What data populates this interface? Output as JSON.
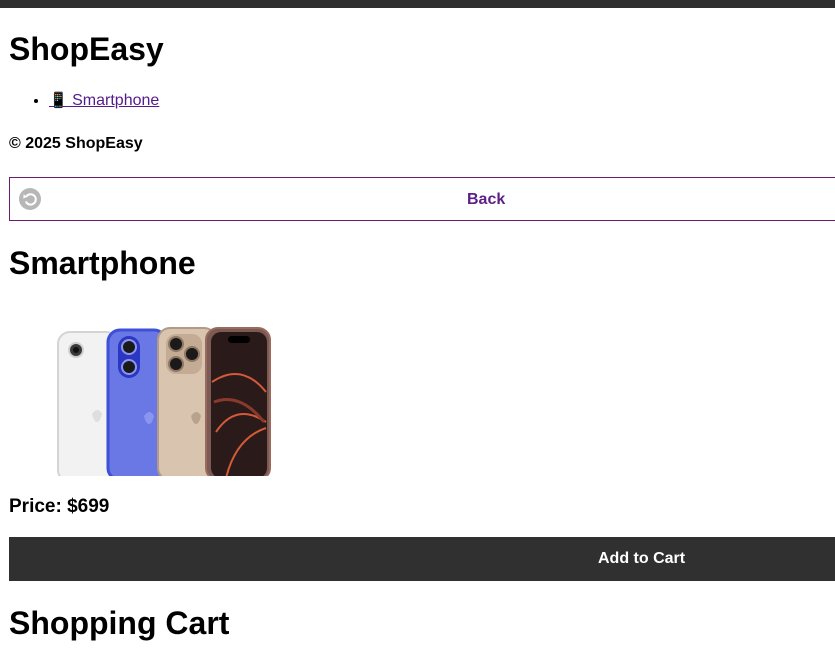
{
  "header": {
    "title": "ShopEasy"
  },
  "nav": {
    "items": [
      {
        "icon": "📱",
        "label": " Smartphone"
      }
    ]
  },
  "footer": {
    "text": "© 2025 ShopEasy"
  },
  "back_button": {
    "label": "Back",
    "icon": "undo-arrow-icon"
  },
  "product": {
    "name": "Smartphone",
    "price_text": "Price: $699",
    "image": "smartphone-lineup-image",
    "add_to_cart_label": "Add to Cart"
  },
  "cart": {
    "title": "Shopping Cart"
  },
  "colors": {
    "topbar": "#2f2f2f",
    "link": "#551a8b",
    "back_label": "#5b1f86",
    "back_border": "#6b1d6b",
    "add_button_bg": "#303030",
    "add_button_text": "#ffffff"
  }
}
